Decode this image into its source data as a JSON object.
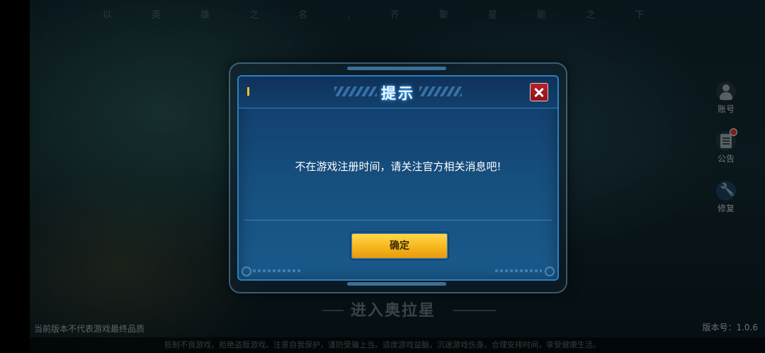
{
  "background": {
    "slogan": "以 英 雄 之 名 , 齐 聚 星 能 之 下"
  },
  "side_menu": {
    "items": [
      {
        "label": "账号",
        "icon": "person-icon"
      },
      {
        "label": "公告",
        "icon": "notice-icon",
        "has_notification": true
      },
      {
        "label": "修复",
        "icon": "wrench-icon"
      }
    ]
  },
  "main": {
    "enter_label": "进入奥拉星"
  },
  "footer": {
    "disclaimer": "当前版本不代表游戏最终品质",
    "version": "版本号：1.0.6",
    "health_notice": "抵制不良游戏，拒绝盗版游戏。注意自我保护，谨防受骗上当。适度游戏益脑，沉迷游戏伤身。合理安排时间，享受健康生活。"
  },
  "dialog": {
    "title": "提示",
    "message": "不在游戏注册时间，请关注官方相关消息吧!",
    "confirm_label": "确定"
  },
  "colors": {
    "dialog_border": "#2f7fc0",
    "confirm_button": "#f5b31a",
    "close_button": "#b5222a"
  }
}
